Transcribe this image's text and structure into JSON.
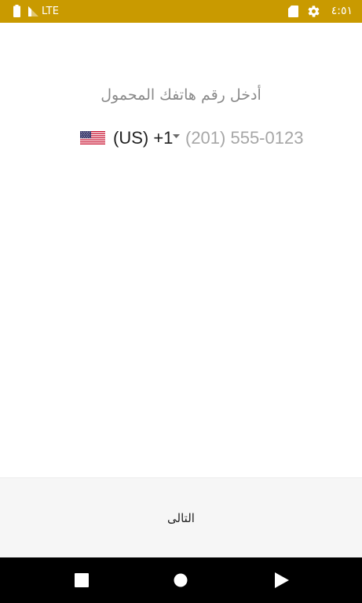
{
  "status_bar": {
    "network_label": "LTE",
    "clock": "٤:٥١",
    "icons": [
      "battery-icon",
      "signal-icon",
      "sd-card-icon",
      "settings-gear-icon"
    ],
    "background_color": "#C99A00"
  },
  "main": {
    "prompt": "أدخل رقم هاتفك المحمول",
    "phone": {
      "country_flag": "us-flag-icon",
      "country_code": "(US) +1",
      "value": "",
      "placeholder": "(201) 555-0123"
    }
  },
  "footer": {
    "next_label": "التالى"
  },
  "nav_bar": {
    "icons": [
      "recents-square-icon",
      "home-circle-icon",
      "back-triangle-icon"
    ]
  }
}
